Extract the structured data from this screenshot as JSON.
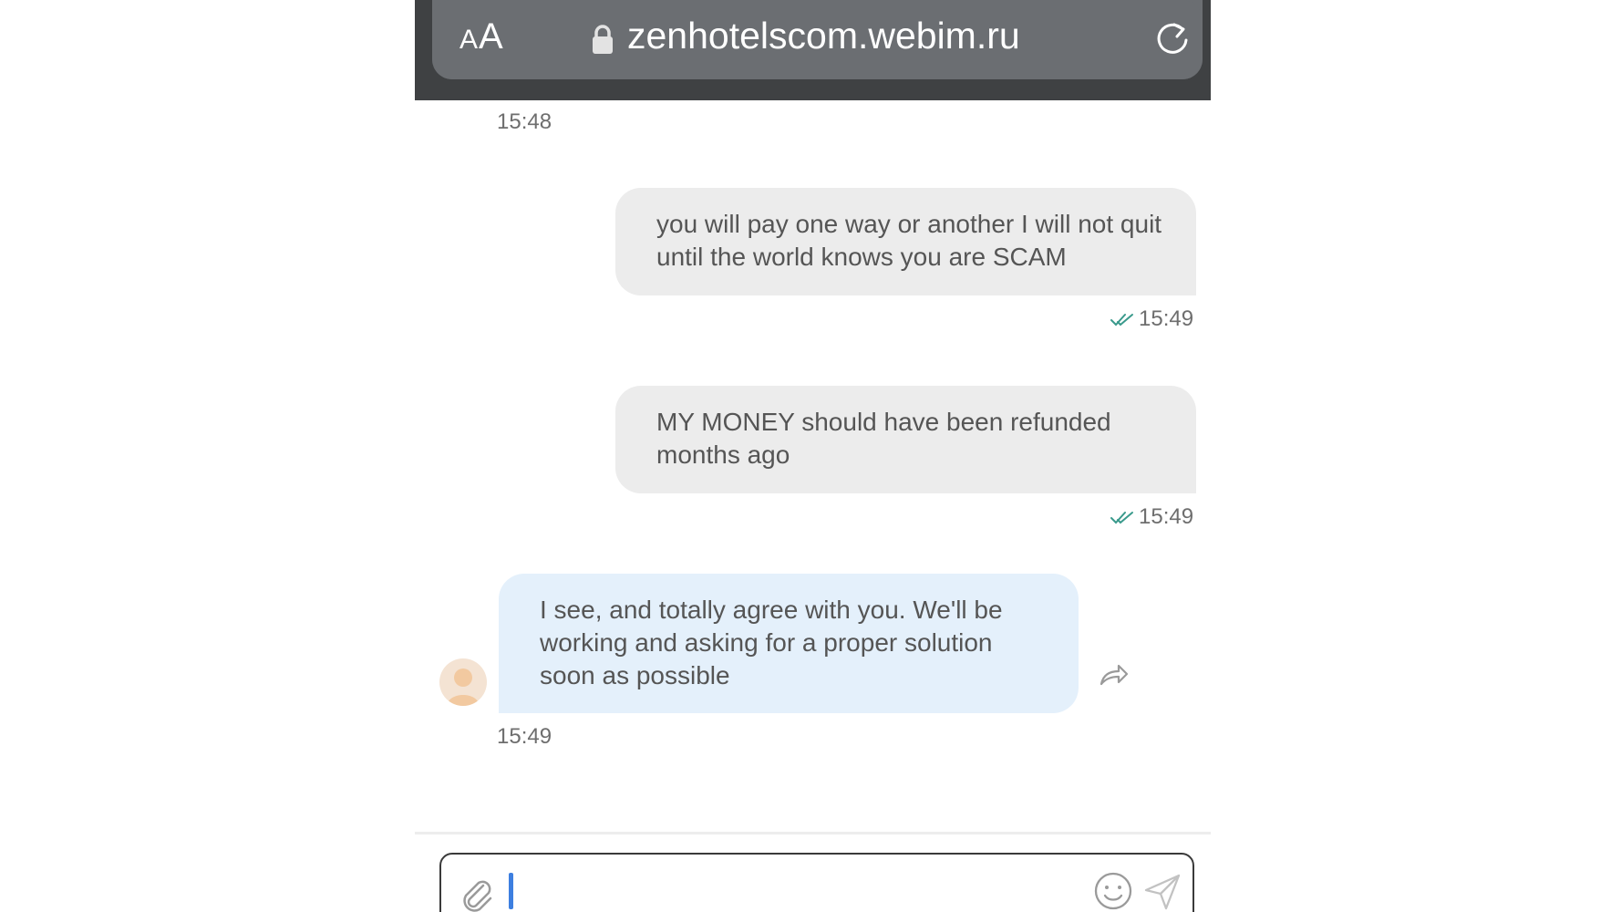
{
  "browser": {
    "text_size_label_small": "A",
    "text_size_label_large": "A",
    "url": "zenhotelscom.webim.ru"
  },
  "messages": [
    {
      "direction": "in",
      "time": "15:48"
    },
    {
      "direction": "out",
      "text": "you will pay one way or another I will not quit until the world knows you are SCAM",
      "time": "15:49",
      "status": "read"
    },
    {
      "direction": "out",
      "text": "MY MONEY should have been refunded months ago",
      "time": "15:49",
      "status": "read"
    },
    {
      "direction": "in",
      "text": "I see, and totally agree with you. We'll be working and asking for a proper solution soon as possible",
      "time": "15:49"
    }
  ],
  "composer": {
    "value": "",
    "placeholder": ""
  },
  "colors": {
    "outgoing_bubble": "#ececec",
    "incoming_bubble": "#e4f0fb",
    "read_check": "#3a9a8c",
    "caret": "#3d7fe0"
  },
  "icons": [
    "lock-icon",
    "reload-icon",
    "double-check-icon",
    "avatar-icon",
    "forward-icon",
    "paperclip-icon",
    "emoji-icon",
    "send-icon"
  ]
}
